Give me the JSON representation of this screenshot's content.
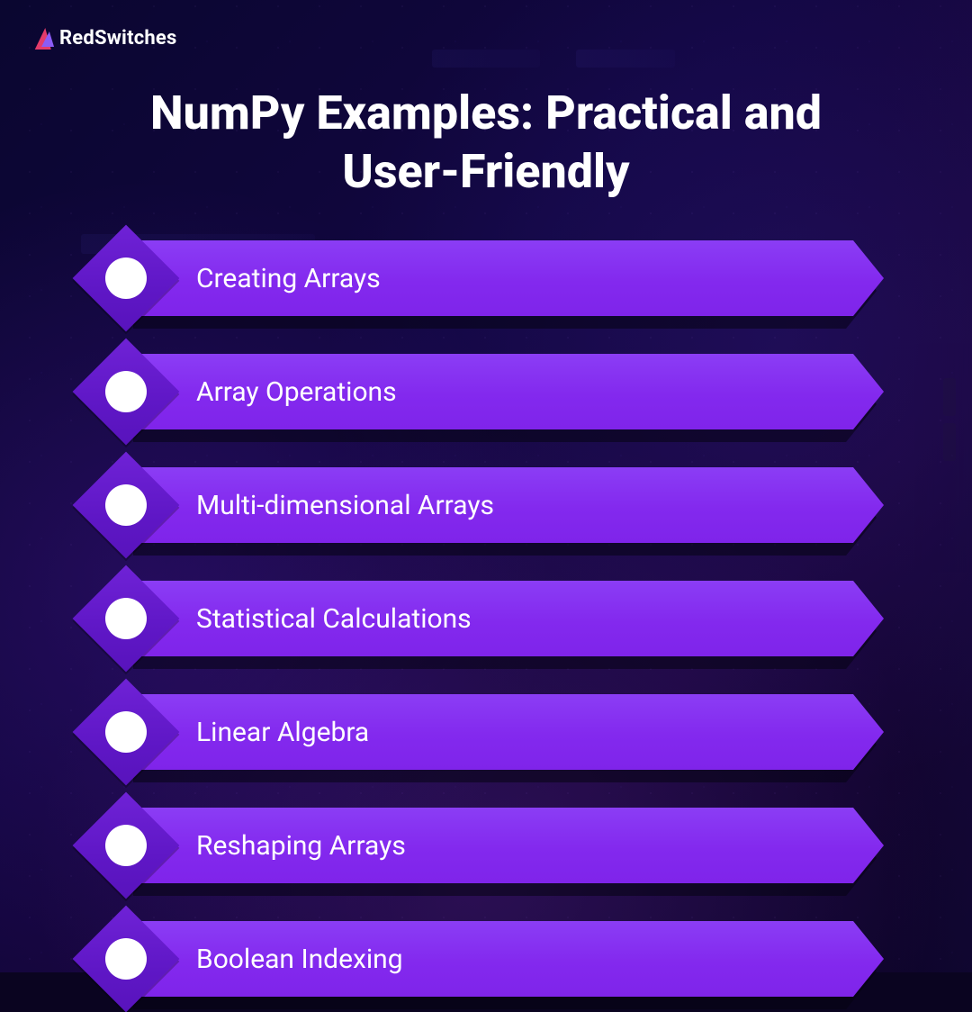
{
  "brand": {
    "name": "RedSwitches"
  },
  "title": "NumPy Examples: Practical and User-Friendly",
  "items": [
    {
      "label": "Creating Arrays"
    },
    {
      "label": "Array Operations"
    },
    {
      "label": "Multi-dimensional Arrays"
    },
    {
      "label": "Statistical Calculations"
    },
    {
      "label": "Linear Algebra"
    },
    {
      "label": "Reshaping Arrays"
    },
    {
      "label": "Boolean Indexing"
    }
  ],
  "colors": {
    "bar": "#8329ee",
    "diamond": "#5f17c6",
    "bullet": "#ffffff",
    "text": "#ffffff",
    "background": "#0a0420"
  }
}
